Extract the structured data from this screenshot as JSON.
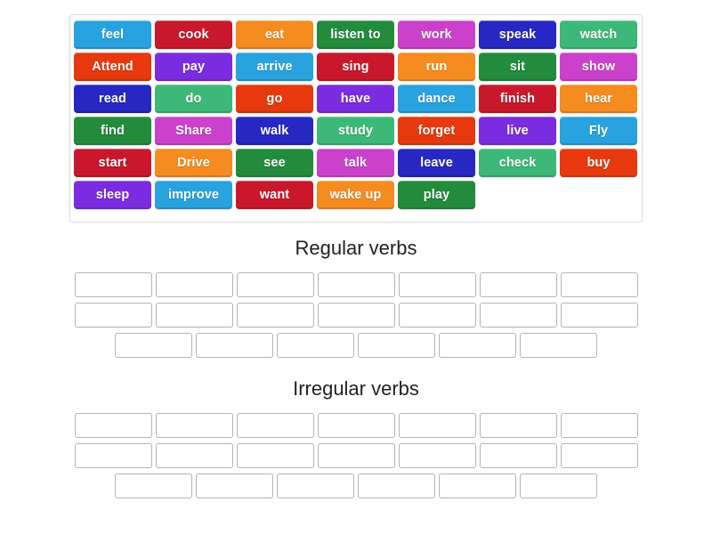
{
  "word_bank": {
    "tiles": [
      {
        "label": "feel",
        "color": "#29a3e0"
      },
      {
        "label": "cook",
        "color": "#c9182b"
      },
      {
        "label": "eat",
        "color": "#f68b1f"
      },
      {
        "label": "listen to",
        "color": "#228b3c"
      },
      {
        "label": "work",
        "color": "#cc41cc"
      },
      {
        "label": "speak",
        "color": "#2727c4"
      },
      {
        "label": "watch",
        "color": "#3cb878"
      },
      {
        "label": "Attend",
        "color": "#e8380d"
      },
      {
        "label": "pay",
        "color": "#7b2ce0"
      },
      {
        "label": "arrive",
        "color": "#29a3e0"
      },
      {
        "label": "sing",
        "color": "#c9182b"
      },
      {
        "label": "run",
        "color": "#f68b1f"
      },
      {
        "label": "sit",
        "color": "#228b3c"
      },
      {
        "label": "show",
        "color": "#cc41cc"
      },
      {
        "label": "read",
        "color": "#2727c4"
      },
      {
        "label": "do",
        "color": "#3cb878"
      },
      {
        "label": "go",
        "color": "#e8380d"
      },
      {
        "label": "have",
        "color": "#7b2ce0"
      },
      {
        "label": "dance",
        "color": "#29a3e0"
      },
      {
        "label": "finish",
        "color": "#c9182b"
      },
      {
        "label": "hear",
        "color": "#f68b1f"
      },
      {
        "label": "find",
        "color": "#228b3c"
      },
      {
        "label": "Share",
        "color": "#cc41cc"
      },
      {
        "label": "walk",
        "color": "#2727c4"
      },
      {
        "label": "study",
        "color": "#3cb878"
      },
      {
        "label": "forget",
        "color": "#e8380d"
      },
      {
        "label": "live",
        "color": "#7b2ce0"
      },
      {
        "label": "Fly",
        "color": "#29a3e0"
      },
      {
        "label": "start",
        "color": "#c9182b"
      },
      {
        "label": "Drive",
        "color": "#f68b1f"
      },
      {
        "label": "see",
        "color": "#228b3c"
      },
      {
        "label": "talk",
        "color": "#cc41cc"
      },
      {
        "label": "leave",
        "color": "#2727c4"
      },
      {
        "label": "check",
        "color": "#3cb878"
      },
      {
        "label": "buy",
        "color": "#e8380d"
      },
      {
        "label": "sleep",
        "color": "#7b2ce0"
      },
      {
        "label": "improve",
        "color": "#29a3e0"
      },
      {
        "label": "want",
        "color": "#c9182b"
      },
      {
        "label": "wake up",
        "color": "#f68b1f"
      },
      {
        "label": "play",
        "color": "#228b3c"
      }
    ]
  },
  "zones": [
    {
      "title": "Regular verbs",
      "rows": [
        [
          "",
          "",
          "",
          "",
          "",
          "",
          ""
        ],
        [
          "",
          "",
          "",
          "",
          "",
          "",
          ""
        ],
        [
          "",
          "",
          "",
          "",
          "",
          ""
        ]
      ]
    },
    {
      "title": "Irregular verbs",
      "rows": [
        [
          "",
          "",
          "",
          "",
          "",
          "",
          ""
        ],
        [
          "",
          "",
          "",
          "",
          "",
          "",
          ""
        ],
        [
          "",
          "",
          "",
          "",
          "",
          ""
        ]
      ]
    }
  ],
  "colors": {
    "panel_border": "#dcdcdc",
    "slot_border": "#b4b4b4",
    "background": "#ffffff",
    "heading_text": "#222222"
  }
}
